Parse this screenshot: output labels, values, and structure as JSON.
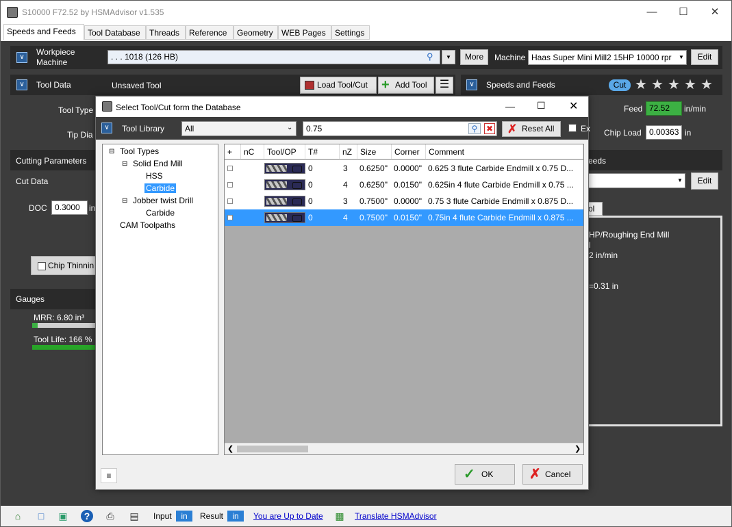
{
  "window": {
    "title": "S10000 F72.52 by HSMAdvisor v1.535"
  },
  "tabs": [
    "Speeds and Feeds",
    "Tool Database",
    "Threads",
    "Reference",
    "Geometry",
    "WEB Pages",
    "Settings"
  ],
  "workpiece": {
    "label_line1": "Workpiece",
    "label_line2": "Machine",
    "material": ". . . 1018 (126 HB)",
    "more_button": "More",
    "machine_label": "Machine",
    "machine_value": "Haas Super Mini Mill2 15HP 10000 rpr",
    "edit_button": "Edit"
  },
  "tool_data": {
    "title": "Tool Data",
    "tool_name": "Unsaved Tool",
    "load_button": "Load Tool/Cut",
    "add_button": "Add Tool",
    "tool_type_label": "Tool Type",
    "tip_dia_label": "Tip Dia"
  },
  "speeds_feeds": {
    "title": "Speeds and Feeds",
    "cut_badge": "Cut",
    "feed_label": "Feed",
    "feed_value": "72.52",
    "feed_unit": "in/min",
    "chip_load_label": "Chip Load",
    "chip_load_value": "0.00363",
    "chip_load_unit": "in",
    "rating_stars": 5
  },
  "cutting_params": {
    "title": "Cutting Parameters",
    "cut_data": "Cut Data",
    "doc_label": "DOC",
    "doc_value": "0.3000",
    "doc_unit": "in",
    "chip_thinning": "Chip Thinnin"
  },
  "right_partial": {
    "feeds_title": "eeds",
    "edit_button": "Edit",
    "tab_frag": "ol",
    "line1": "HP/Roughing End Mill",
    "line2": "l",
    "line3": "2 in/min",
    "line4": "=0.31 in"
  },
  "gauges": {
    "title": "Gauges",
    "mrr": "MRR: 6.80 in³",
    "tool_life": "Tool Life: 166 %",
    "mrr_fraction": 0.08,
    "tool_life_fraction": 1.0
  },
  "dialog": {
    "title": "Select Tool/Cut form the Database",
    "library_label": "Tool Library",
    "filter_value": "All",
    "search_value": "0.75",
    "reset_button": "Reset All",
    "ex_label": "Ex",
    "tree": {
      "root": "Tool Types",
      "solid": "Solid End Mill",
      "hss": "HSS",
      "carbide": "Carbide",
      "jobber": "Jobber twist Drill",
      "jobber_carbide": "Carbide",
      "cam": "CAM Toolpaths"
    },
    "columns": [
      "+",
      "nC",
      "Tool/OP",
      "T#",
      "nZ",
      "Size",
      "Corner",
      "Comment"
    ],
    "rows": [
      {
        "t": "0",
        "nz": "3",
        "size": "0.6250\"",
        "corner": "0.0000\"",
        "comment": "0.625 3 flute Carbide Endmill x 0.75 D..."
      },
      {
        "t": "0",
        "nz": "4",
        "size": "0.6250\"",
        "corner": "0.0150\"",
        "comment": "0.625in 4 flute Carbide Endmill x 0.75 ..."
      },
      {
        "t": "0",
        "nz": "3",
        "size": "0.7500\"",
        "corner": "0.0000\"",
        "comment": "0.75 3 flute Carbide Endmill x 0.875 D..."
      },
      {
        "t": "0",
        "nz": "4",
        "size": "0.7500\"",
        "corner": "0.0150\"",
        "comment": "0.75in 4 flute Carbide Endmill x 0.875 ..."
      }
    ],
    "ok_button": "OK",
    "cancel_button": "Cancel"
  },
  "statusbar": {
    "input_label": "Input",
    "input_unit": "in",
    "result_label": "Result",
    "result_unit": "in",
    "update_link": "You are Up to Date",
    "translate_link": "Translate HSMAdvisor"
  }
}
